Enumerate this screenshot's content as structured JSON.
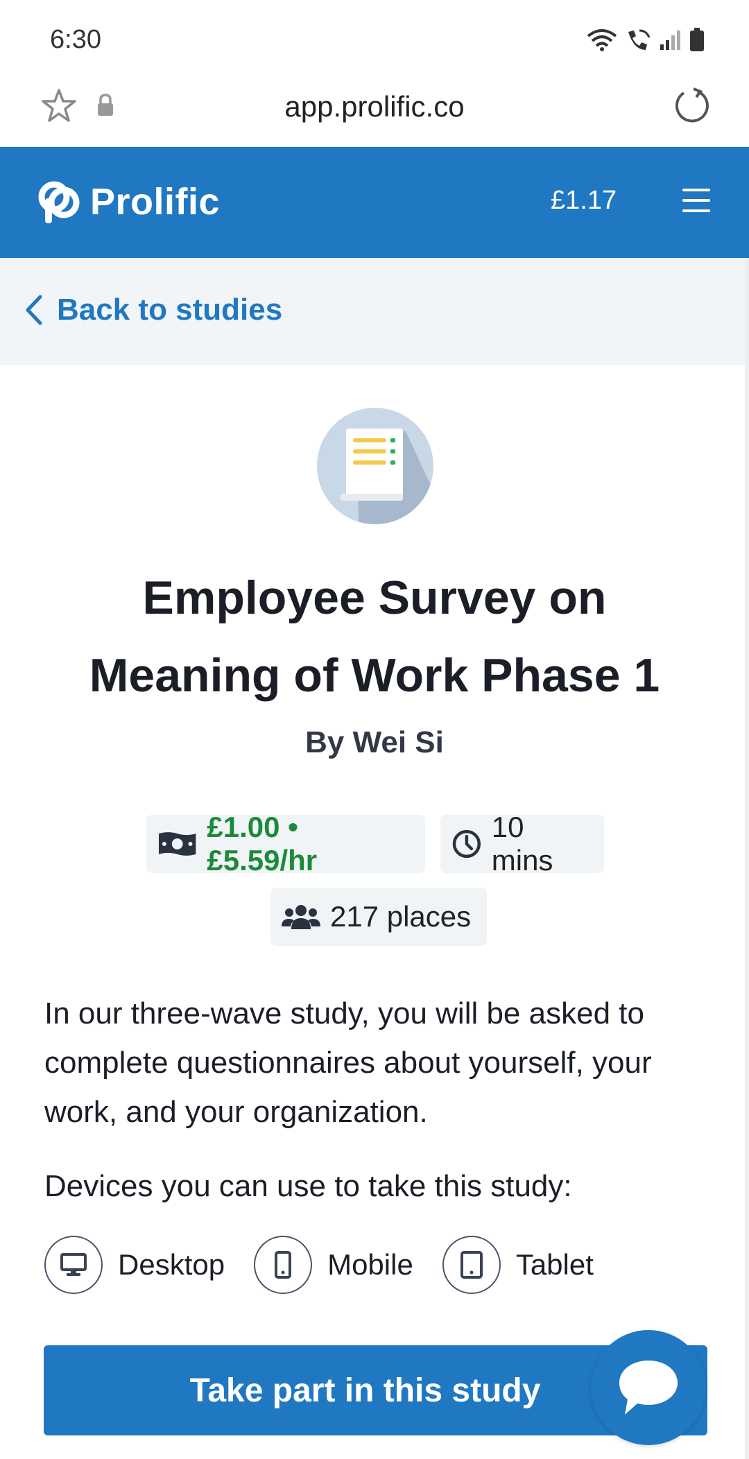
{
  "status_bar": {
    "time": "6:30"
  },
  "browser": {
    "url": "app.prolific.co"
  },
  "header": {
    "logo_text": "Prolific",
    "balance": "£1.17"
  },
  "back_link": {
    "label": "Back to studies"
  },
  "study": {
    "title": "Employee Survey on Meaning of Work Phase 1",
    "author": "By Wei Si",
    "reward": "£1.00 • £5.59/hr",
    "duration": "10 mins",
    "places": "217 places",
    "description": "In our three-wave study, you will be asked to complete questionnaires about yourself, your work, and your organization.",
    "devices_heading": "Devices you can use to take this study:",
    "devices": [
      {
        "label": "Desktop",
        "icon": "desktop-icon"
      },
      {
        "label": "Mobile",
        "icon": "mobile-icon"
      },
      {
        "label": "Tablet",
        "icon": "tablet-icon"
      }
    ],
    "cta_label": "Take part in this study"
  },
  "colors": {
    "brand": "#1f78c1",
    "reward": "#1b8a3a",
    "chip_bg": "#f1f4f6"
  }
}
